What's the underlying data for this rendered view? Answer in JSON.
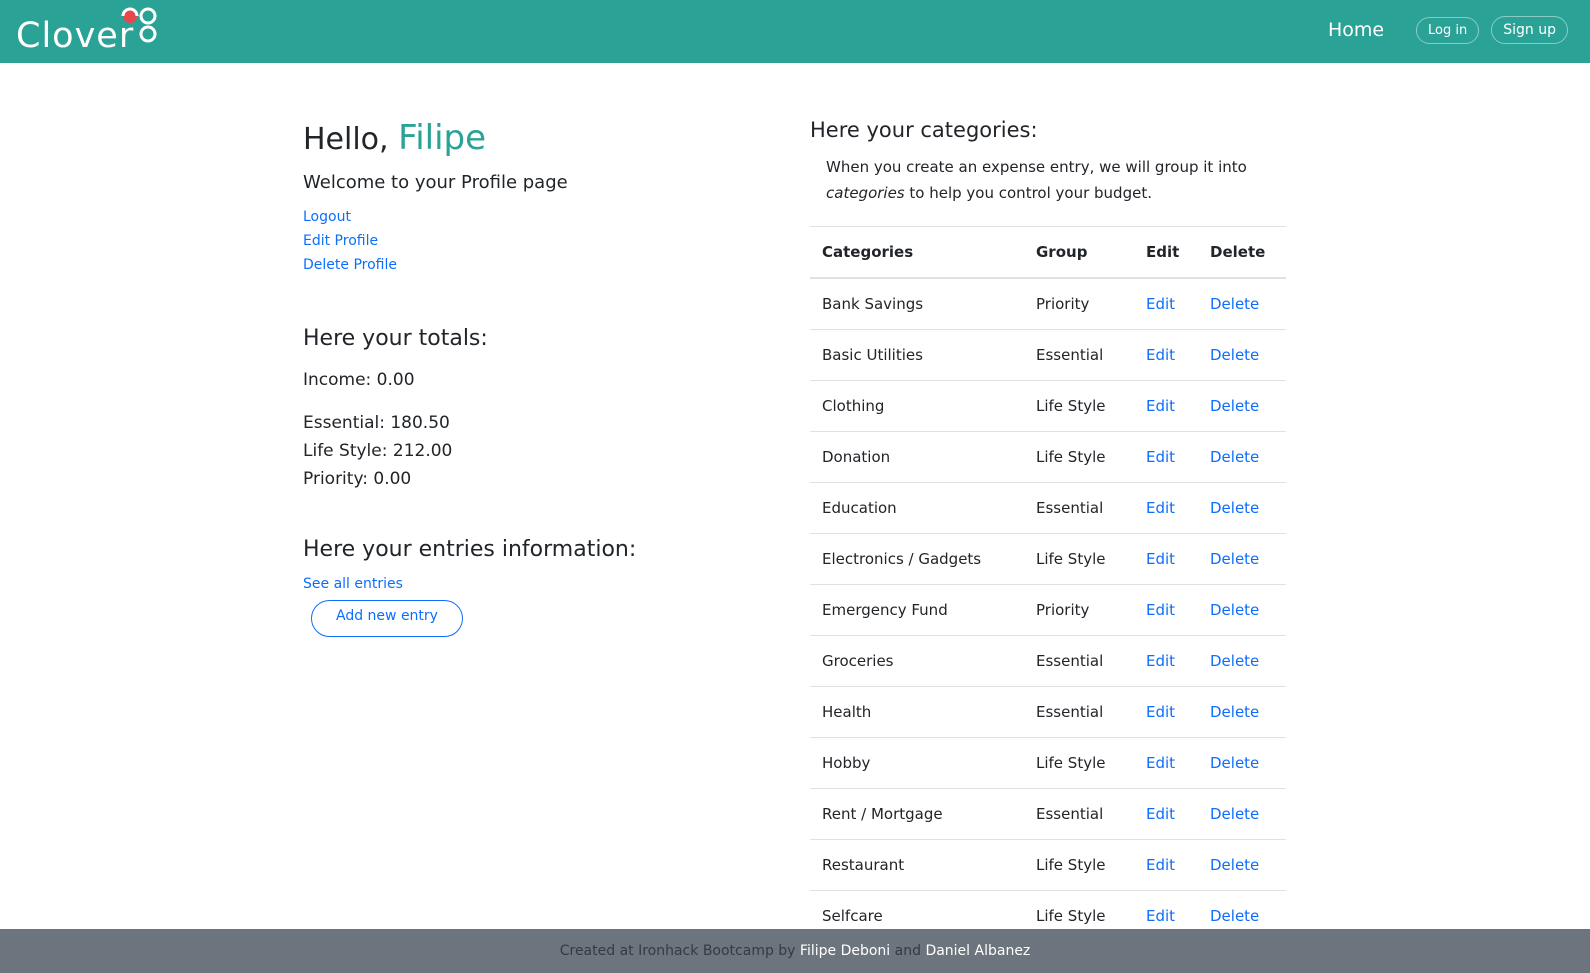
{
  "navbar": {
    "brand": "Clover",
    "home": "Home",
    "login": "Log in",
    "signup": "Sign up",
    "accent_color": "#2ba296"
  },
  "profile": {
    "greeting": "Hello, ",
    "name": "Filipe",
    "welcome": "Welcome to your Profile page",
    "links": {
      "logout": "Logout",
      "edit": "Edit Profile",
      "delete": "Delete Profile"
    }
  },
  "totals": {
    "title": "Here your totals:",
    "income": "Income: 0.00",
    "essential": "Essential: 180.50",
    "lifestyle": "Life Style: 212.00",
    "priority": "Priority: 0.00"
  },
  "entries": {
    "title": "Here your entries information:",
    "see_all": "See all entries",
    "add_new": "Add new entry"
  },
  "categories": {
    "title": "Here your categories:",
    "desc_before": "When you create an expense entry, we will group it into ",
    "desc_em": "categories",
    "desc_after": " to help you control your budget.",
    "headers": [
      "Categories",
      "Group",
      "Edit",
      "Delete"
    ],
    "edit_label": "Edit",
    "delete_label": "Delete",
    "rows": [
      {
        "name": "Bank Savings",
        "group": "Priority"
      },
      {
        "name": "Basic Utilities",
        "group": "Essential"
      },
      {
        "name": "Clothing",
        "group": "Life Style"
      },
      {
        "name": "Donation",
        "group": "Life Style"
      },
      {
        "name": "Education",
        "group": "Essential"
      },
      {
        "name": "Electronics / Gadgets",
        "group": "Life Style"
      },
      {
        "name": "Emergency Fund",
        "group": "Priority"
      },
      {
        "name": "Groceries",
        "group": "Essential"
      },
      {
        "name": "Health",
        "group": "Essential"
      },
      {
        "name": "Hobby",
        "group": "Life Style"
      },
      {
        "name": "Rent / Mortgage",
        "group": "Essential"
      },
      {
        "name": "Restaurant",
        "group": "Life Style"
      },
      {
        "name": "Selfcare",
        "group": "Life Style"
      }
    ]
  },
  "footer": {
    "text1": "Created at Ironhack Bootcamp by ",
    "author1": "Filipe Deboni",
    "text2": " and ",
    "author2": "Daniel Albanez"
  }
}
